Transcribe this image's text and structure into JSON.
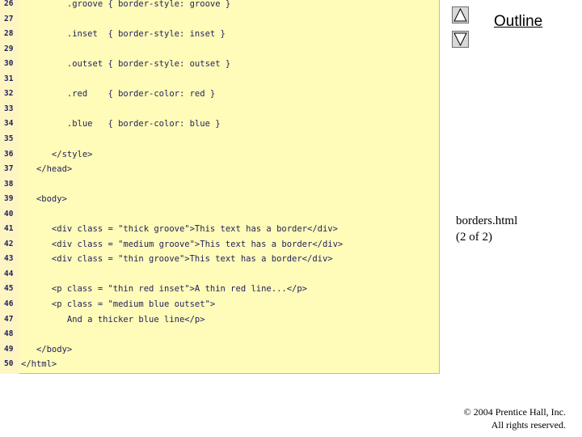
{
  "code_lines": [
    {
      "num": "26",
      "text": "         .groove { border-style: groove }"
    },
    {
      "num": "27",
      "text": ""
    },
    {
      "num": "28",
      "text": "         .inset  { border-style: inset }"
    },
    {
      "num": "29",
      "text": ""
    },
    {
      "num": "30",
      "text": "         .outset { border-style: outset }"
    },
    {
      "num": "31",
      "text": ""
    },
    {
      "num": "32",
      "text": "         .red    { border-color: red }"
    },
    {
      "num": "33",
      "text": ""
    },
    {
      "num": "34",
      "text": "         .blue   { border-color: blue }"
    },
    {
      "num": "35",
      "text": ""
    },
    {
      "num": "36",
      "text": "      </style>"
    },
    {
      "num": "37",
      "text": "   </head>"
    },
    {
      "num": "38",
      "text": ""
    },
    {
      "num": "39",
      "text": "   <body>"
    },
    {
      "num": "40",
      "text": ""
    },
    {
      "num": "41",
      "text": "      <div class = \"thick groove\">This text has a border</div>"
    },
    {
      "num": "42",
      "text": "      <div class = \"medium groove\">This text has a border</div>"
    },
    {
      "num": "43",
      "text": "      <div class = \"thin groove\">This text has a border</div>"
    },
    {
      "num": "44",
      "text": ""
    },
    {
      "num": "45",
      "text": "      <p class = \"thin red inset\">A thin red line...</p>"
    },
    {
      "num": "46",
      "text": "      <p class = \"medium blue outset\">"
    },
    {
      "num": "47",
      "text": "         And a thicker blue line</p>"
    },
    {
      "num": "48",
      "text": ""
    },
    {
      "num": "49",
      "text": "   </body>"
    },
    {
      "num": "50",
      "text": "</html>"
    }
  ],
  "nav": {
    "up_icon": "triangle-up-icon",
    "down_icon": "triangle-down-icon"
  },
  "outline_label": "Outline",
  "file_info": {
    "name": "borders.html",
    "page": "(2 of 2)"
  },
  "copyright": {
    "line1": "© 2004 Prentice Hall, Inc.",
    "line2": "All rights reserved."
  },
  "colors": {
    "code_background": "#fffbb8",
    "gutter_background": "#fdf6c3",
    "code_text": "#1f1f5a",
    "nav_button": "#d8d8d8"
  }
}
